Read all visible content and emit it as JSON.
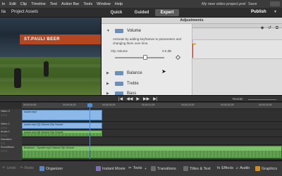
{
  "menubar": {
    "items": [
      "le",
      "Edit",
      "Clip",
      "Timeline",
      "Text",
      "Action Bar",
      "Tools",
      "Window",
      "Help"
    ],
    "document": "My new video project.prel",
    "save": "Save"
  },
  "toolbar": {
    "project_label": "lia",
    "assets_label": "Project Assets",
    "modes": [
      "Quick",
      "Guided",
      "Expert"
    ],
    "active_mode": "Expert",
    "publish_label": "Publish"
  },
  "monitor": {
    "banner_text": "ST.PAULI BEER"
  },
  "adjustments": {
    "title": "Adjustments",
    "sections": {
      "volume": "Volume",
      "balance": "Balance",
      "treble": "Treble",
      "bass": "Bass"
    },
    "animate_note": "Animate by adding keyframes to parameters and changing them over time.",
    "clip_volume": {
      "label": "Clip Volume",
      "value": "0.0 dB",
      "level": 0.62
    }
  },
  "transport": {
    "controls": [
      "|◀",
      "◀◀",
      "▶",
      "▶▶",
      "▶|"
    ],
    "render_label": "Render"
  },
  "timeline": {
    "ruler_labels": [
      "00;00;00;00",
      "00;00;04;29",
      "00;00;09;29",
      "00;00;14;29",
      "00;00;19;29",
      "00;00;24;29",
      "00;00;29;29"
    ],
    "tracks": [
      {
        "name": "Video 2",
        "buttons": "◻ ◻ ◻"
      },
      {
        "name": "Video 1",
        "buttons": "◻ ◻ ◻"
      },
      {
        "name": "Audio 1",
        "buttons": "◻ ◻ ◻"
      },
      {
        "name": "Narration",
        "buttons": "◻ ◻"
      },
      {
        "name": "Soundtrack",
        "buttons": "◻ ◻ ◻"
      }
    ],
    "clips": {
      "video2": "soccer.mp4",
      "video1": "soccer.mp4 [V] Volume:Clip Volume ·",
      "audio1": "soccer.mp4 [A] Volume:Clip Volume ·",
      "soundtrack": "Beatbase – Sportier.mp3 Volume:Clip Volume ·"
    }
  },
  "bottombar": {
    "undo": "Undo",
    "redo": "Redo",
    "organizer": "Organizer",
    "instant_movie": "Instant Movie",
    "tools": "Tools",
    "transitions": "Transitions",
    "titles": "Titles & Text",
    "effects": "Effects",
    "audio": "Audio",
    "graphics": "Graphics"
  },
  "colors": {
    "accent": "#4a8fd8",
    "video_clip": "#8bb8e6",
    "audio_clip": "#7dc26a",
    "keyframe_marker": "#f0c21a"
  }
}
